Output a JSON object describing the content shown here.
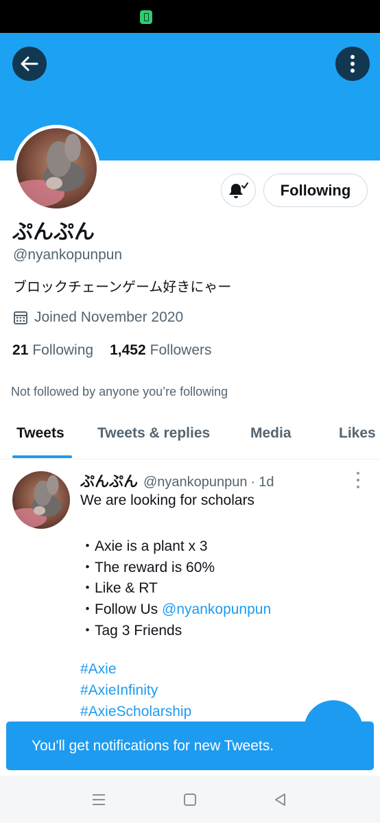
{
  "status_bar": {
    "icon": "battery-saver-icon",
    "accent": "#2ecc71"
  },
  "header": {
    "back_icon": "arrow-left-icon",
    "more_icon": "more-vertical-icon",
    "banner_color": "#1da1f2"
  },
  "profile": {
    "display_name": "ぷんぷん",
    "handle": "@nyankopunpun",
    "bio": "ブロックチェーンゲーム好きにゃー",
    "joined": "Joined November 2020",
    "following_count": "21",
    "following_label": "Following",
    "followers_count": "1,452",
    "followers_label": "Followers",
    "not_followed_text": "Not followed by anyone you’re following",
    "follow_button_label": "Following",
    "notify_icon": "bell-check-icon"
  },
  "tabs": [
    {
      "label": "Tweets",
      "active": true
    },
    {
      "label": "Tweets & replies",
      "active": false
    },
    {
      "label": "Media",
      "active": false
    },
    {
      "label": "Likes",
      "active": false
    }
  ],
  "tweet": {
    "name": "ぷんぷん",
    "handle": "@nyankopunpun",
    "separator": "·",
    "time": "1d",
    "lines": {
      "intro": "We are looking for scholars",
      "b1": "・Axie is a plant x 3",
      "b2": "・The reward is 60%",
      "b3": "・Like & RT",
      "b4_prefix": "・Follow Us ",
      "b4_mention": "@nyankopunpun",
      "b5": "・Tag 3 Friends",
      "tag1": "#Axie",
      "tag2": "#AxieInfinity",
      "tag3": "#AxieScholarship"
    }
  },
  "toast": {
    "text": "You'll get notifications for new Tweets."
  },
  "navbar": {
    "icons": [
      "menu-icon",
      "home-square-icon",
      "back-triangle-icon"
    ]
  },
  "colors": {
    "accent": "#1d9bf0",
    "text_primary": "#0f1419",
    "text_secondary": "#536471"
  }
}
